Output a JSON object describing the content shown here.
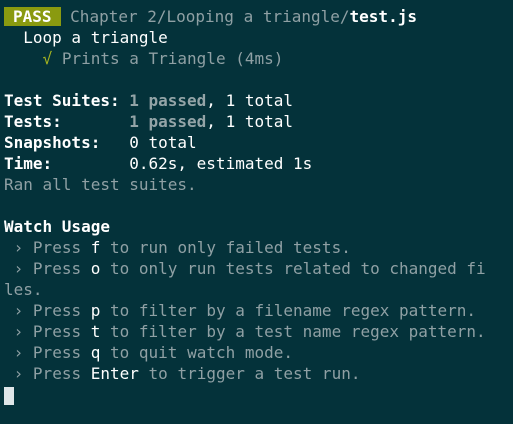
{
  "header": {
    "badge": "PASS",
    "path_dir": "Chapter 2/Looping a triangle/",
    "path_file": "test.js"
  },
  "suite": {
    "describe": "Loop a triangle",
    "check_mark": "√",
    "test_name": "Prints a Triangle",
    "test_time": "(4ms)"
  },
  "summary": {
    "suites_label": "Test Suites:",
    "suites_passed": "1 passed",
    "suites_total": ", 1 total",
    "tests_label": "Tests:",
    "tests_passed": "1 passed",
    "tests_total": ", 1 total",
    "snapshots_label": "Snapshots:",
    "snapshots_value": "0 total",
    "time_label": "Time:",
    "time_value": "0.62s, estimated 1s",
    "ran_all": "Ran all test suites."
  },
  "watch": {
    "title": "Watch Usage",
    "bullet": "›",
    "press": "Press",
    "items": [
      {
        "key": "f",
        "text": " to run only failed tests."
      },
      {
        "key": "o",
        "text": " to only run tests related to changed fi",
        "wrap": "les."
      },
      {
        "key": "p",
        "text": " to filter by a filename regex pattern."
      },
      {
        "key": "t",
        "text": " to filter by a test name regex pattern."
      },
      {
        "key": "q",
        "text": " to quit watch mode."
      },
      {
        "key": "Enter",
        "text": " to trigger a test run."
      }
    ]
  },
  "colors": {
    "background": "#04323a",
    "pass_badge": "#8a9a10",
    "check_green": "#a6b520",
    "dim_text": "#8fa0a4",
    "bright_text": "#ffffff",
    "cursor": "#dfe6e8"
  }
}
